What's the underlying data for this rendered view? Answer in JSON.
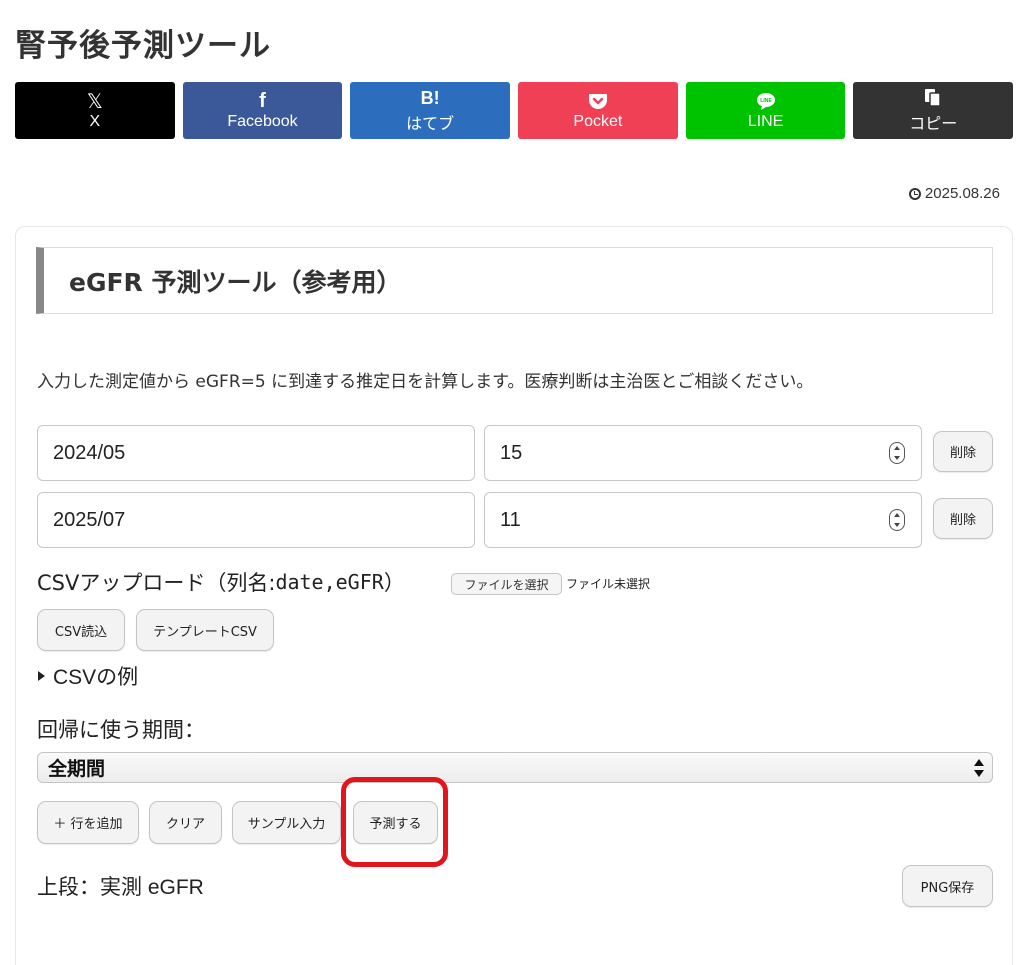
{
  "page": {
    "title": "腎予後予測ツール"
  },
  "share": {
    "x": {
      "icon": "𝕏",
      "label": "X"
    },
    "facebook": {
      "icon": "f",
      "label": "Facebook"
    },
    "hatena": {
      "icon": "B!",
      "label": "はてブ"
    },
    "pocket": {
      "icon": "pocket-icon",
      "label": "Pocket"
    },
    "line": {
      "icon": "line-icon",
      "label": "LINE"
    },
    "copy": {
      "icon": "copy-icon",
      "label": "コピー"
    }
  },
  "post": {
    "date": "2025.08.26"
  },
  "tool": {
    "heading": "eGFR 予測ツール（参考用）",
    "intro": "入力した測定値から eGFR=5 に到達する推定日を計算します。医療判断は主治医とご相談ください。",
    "rows": [
      {
        "date": "2024/05",
        "egfr": "15",
        "delete_label": "削除"
      },
      {
        "date": "2025/07",
        "egfr": "11",
        "delete_label": "削除"
      }
    ],
    "csv": {
      "label_prefix": "CSVアップロード（列名: ",
      "columns": "date,eGFR",
      "label_suffix": "）",
      "file_button": "ファイルを選択",
      "file_status": "ファイル未選択",
      "read_button": "CSV読込",
      "template_button": "テンプレートCSV",
      "example_summary": "CSVの例"
    },
    "period": {
      "label": "回帰に使う期間：",
      "selected": "全期間"
    },
    "actions": {
      "add_row": "＋ 行を追加",
      "clear": "クリア",
      "sample": "サンプル入力",
      "predict": "予測する"
    },
    "chart_caption": "上段：実測 eGFR",
    "png_save": "PNG保存"
  },
  "colors": {
    "x": "#000000",
    "facebook": "#3b5998",
    "hatena": "#2c6ebd",
    "pocket": "#ef4056",
    "line": "#00c300",
    "copy": "#333333",
    "highlight": "#e3141c"
  }
}
